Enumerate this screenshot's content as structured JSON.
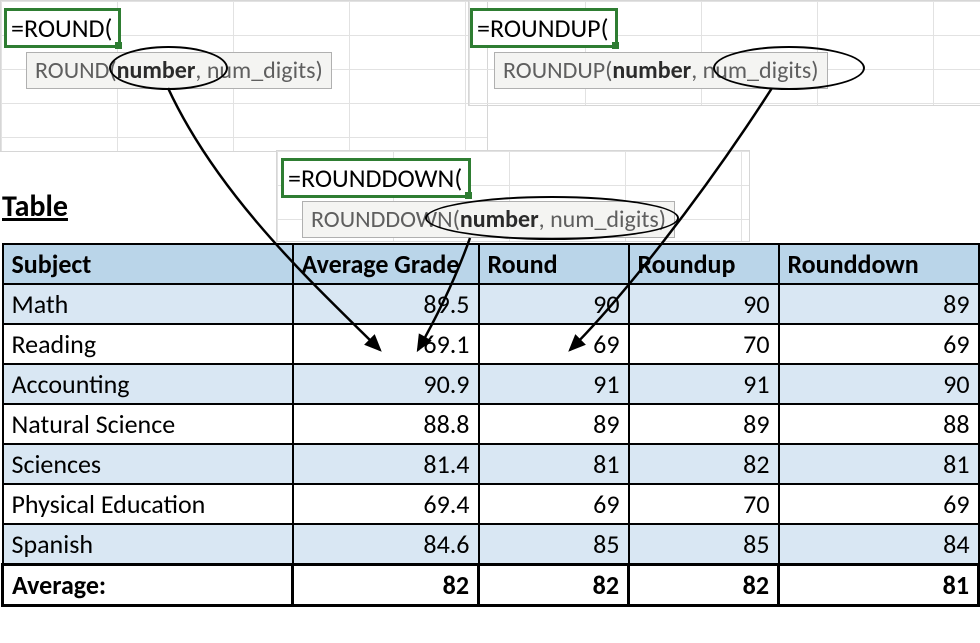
{
  "formulas": {
    "round": {
      "cell": "=ROUND(",
      "tip_fn": "ROUND(",
      "arg_bold": "number",
      "tip_rest": ", num_digits)"
    },
    "roundup": {
      "cell": "=ROUNDUP(",
      "tip_fn": "ROUNDUP(",
      "arg_bold": "number",
      "tip_rest": ", num_digits)"
    },
    "rounddown": {
      "cell": "=ROUNDDOWN(",
      "tip_fn": "ROUNDDOWN(",
      "arg_bold": "number",
      "tip_rest": ", num_digits)"
    }
  },
  "title": "Table",
  "headers": [
    "Subject",
    "Average Grade",
    "Round",
    "Roundup",
    "Rounddown"
  ],
  "rows": [
    {
      "subject": "Math",
      "avg": "89.5",
      "round": "90",
      "roundup": "90",
      "rounddown": "89"
    },
    {
      "subject": "Reading",
      "avg": "69.1",
      "round": "69",
      "roundup": "70",
      "rounddown": "69"
    },
    {
      "subject": "Accounting",
      "avg": "90.9",
      "round": "91",
      "roundup": "91",
      "rounddown": "90"
    },
    {
      "subject": "Natural Science",
      "avg": "88.8",
      "round": "89",
      "roundup": "89",
      "rounddown": "88"
    },
    {
      "subject": "Sciences",
      "avg": "81.4",
      "round": "81",
      "roundup": "82",
      "rounddown": "81"
    },
    {
      "subject": "Physical Education",
      "avg": "69.4",
      "round": "69",
      "roundup": "70",
      "rounddown": "69"
    },
    {
      "subject": "Spanish",
      "avg": "84.6",
      "round": "85",
      "roundup": "85",
      "rounddown": "84"
    }
  ],
  "average_row": {
    "label": "Average:",
    "avg": "82",
    "round": "82",
    "roundup": "82",
    "rounddown": "81"
  }
}
